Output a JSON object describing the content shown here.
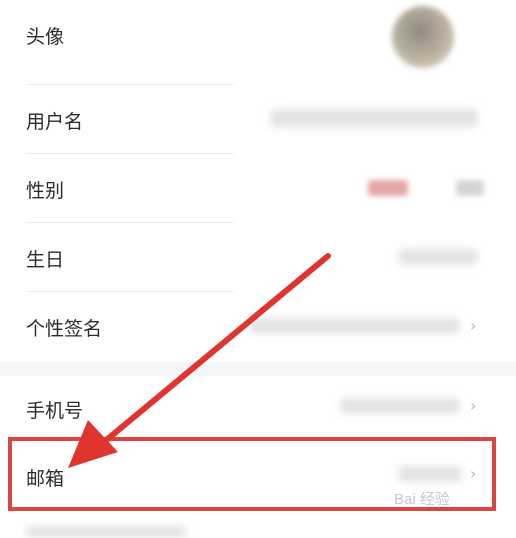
{
  "profile": {
    "items": [
      {
        "label": "头像"
      },
      {
        "label": "用户名"
      },
      {
        "label": "性别"
      },
      {
        "label": "生日"
      },
      {
        "label": "个性签名"
      },
      {
        "label": "手机号"
      },
      {
        "label": "邮箱"
      }
    ]
  },
  "watermark": {
    "text": "Bai 经验"
  },
  "annotation": {
    "color": "#d9453f"
  },
  "icons": {
    "chevron": "chevron-right-icon",
    "avatar": "avatar-image"
  }
}
